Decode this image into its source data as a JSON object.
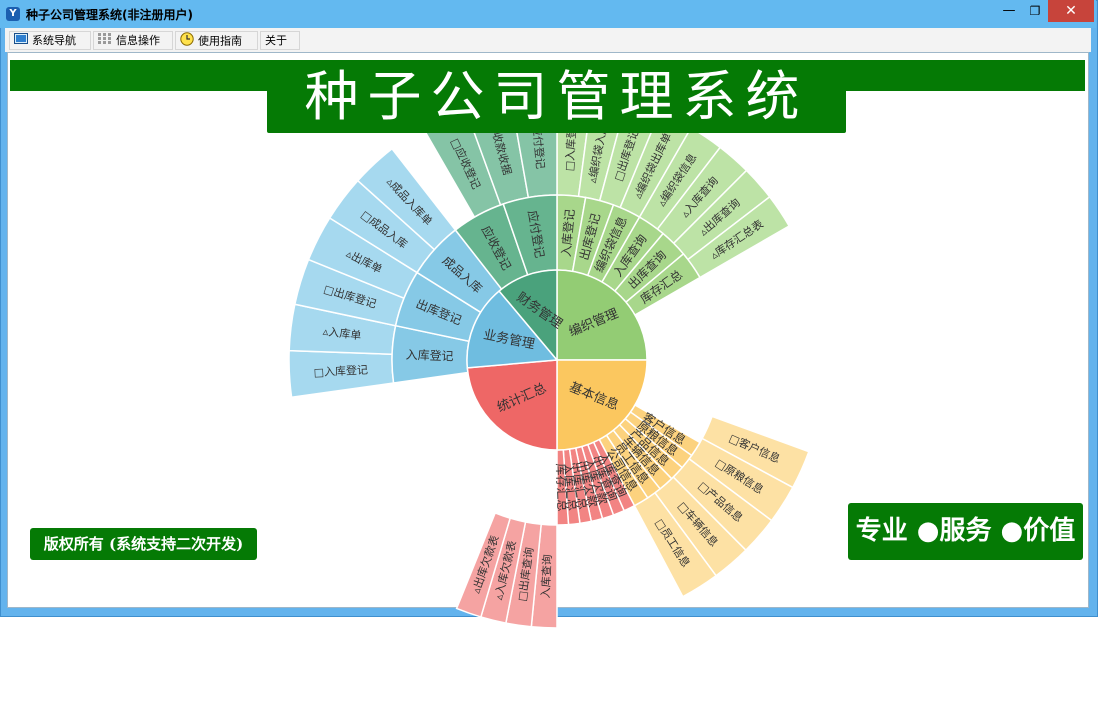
{
  "window": {
    "title": "种子公司管理系统(非注册用户)",
    "controls": {
      "minimize": "—",
      "restore": "❐",
      "close": "✕"
    }
  },
  "menubar": [
    {
      "label": "系统导航",
      "icon": "monitor-icon"
    },
    {
      "label": "信息操作",
      "icon": "grid-icon"
    },
    {
      "label": "使用指南",
      "icon": "clock-icon"
    },
    {
      "label": "关于",
      "icon": ""
    }
  ],
  "banner": {
    "title": "种子公司管理系统"
  },
  "copyright": "版权所有 (系统支持二次开发)",
  "slogan": "专业 ●服务 ●价值",
  "colors": {
    "brand_green": "#057a05",
    "biz": [
      "#6fbde0",
      "#86c9e6",
      "#a6d9ef"
    ],
    "fin": [
      "#4aa27c",
      "#66b48f",
      "#85c4a6"
    ],
    "weave": [
      "#93cc74",
      "#a8d78b",
      "#bde3a6"
    ],
    "basic": [
      "#fbc75f",
      "#fcd27e",
      "#fde1a4"
    ],
    "stats": [
      "#ee6766",
      "#f28483",
      "#f5a3a2"
    ]
  },
  "sunburst": {
    "inner": [
      {
        "label": "编织管理",
        "group": "weave"
      },
      {
        "label": "基本信息",
        "group": "basic"
      },
      {
        "label": "统计汇总",
        "group": "stats"
      },
      {
        "label": "业务管理",
        "group": "biz"
      },
      {
        "label": "财务管理",
        "group": "fin"
      }
    ],
    "middle": [
      {
        "label": "入库登记",
        "group": "weave"
      },
      {
        "label": "出库登记",
        "group": "weave"
      },
      {
        "label": "编织袋信息",
        "group": "weave"
      },
      {
        "label": "入库查询",
        "group": "weave"
      },
      {
        "label": "出库查询",
        "group": "weave"
      },
      {
        "label": "库存汇总",
        "group": "weave"
      },
      {
        "label": "客户信息",
        "group": "basic"
      },
      {
        "label": "原粮信息",
        "group": "basic"
      },
      {
        "label": "产品信息",
        "group": "basic"
      },
      {
        "label": "车辆信息",
        "group": "basic"
      },
      {
        "label": "员工信息",
        "group": "basic"
      },
      {
        "label": "公司信息",
        "group": "basic"
      },
      {
        "label": "入库查询",
        "group": "stats"
      },
      {
        "label": "出库查询",
        "group": "stats"
      },
      {
        "label": "入库欠款",
        "group": "stats"
      },
      {
        "label": "出库欠款",
        "group": "stats"
      },
      {
        "label": "出库汇总",
        "group": "stats"
      },
      {
        "label": "入库汇总",
        "group": "stats"
      },
      {
        "label": "库存汇总",
        "group": "stats"
      },
      {
        "label": "入库登记",
        "group": "biz"
      },
      {
        "label": "出库登记",
        "group": "biz"
      },
      {
        "label": "成品入库",
        "group": "biz"
      },
      {
        "label": "应收登记",
        "group": "fin"
      },
      {
        "label": "应付登记",
        "group": "fin"
      }
    ],
    "outer": [
      {
        "label": "□入库登记",
        "group": "weave"
      },
      {
        "label": "▵编织袋入库单",
        "group": "weave"
      },
      {
        "label": "□出库登记",
        "group": "weave"
      },
      {
        "label": "▵编织袋出库单",
        "group": "weave"
      },
      {
        "label": "▵编织袋信息",
        "group": "weave"
      },
      {
        "label": "▵入库查询",
        "group": "weave"
      },
      {
        "label": "▵出库查询",
        "group": "weave"
      },
      {
        "label": "▵库存汇总表",
        "group": "weave"
      },
      {
        "label": "□客户信息",
        "group": "basic"
      },
      {
        "label": "□原粮信息",
        "group": "basic"
      },
      {
        "label": "□产品信息",
        "group": "basic"
      },
      {
        "label": "□车辆信息",
        "group": "basic"
      },
      {
        "label": "□员工信息",
        "group": "basic"
      },
      {
        "label": "入库查询",
        "group": "stats"
      },
      {
        "label": "□出库查询",
        "group": "stats"
      },
      {
        "label": "▵入库欠款表",
        "group": "stats"
      },
      {
        "label": "▵出库欠款表",
        "group": "stats"
      },
      {
        "label": "□入库登记",
        "group": "biz"
      },
      {
        "label": "▵入库单",
        "group": "biz"
      },
      {
        "label": "□出库登记",
        "group": "biz"
      },
      {
        "label": "▵出库单",
        "group": "biz"
      },
      {
        "label": "□成品入库",
        "group": "biz"
      },
      {
        "label": "▵成品入库单",
        "group": "biz"
      },
      {
        "label": "□应收登记",
        "group": "fin"
      },
      {
        "label": "▵收款收据",
        "group": "fin"
      },
      {
        "label": "▵应付登记",
        "group": "fin"
      }
    ]
  }
}
